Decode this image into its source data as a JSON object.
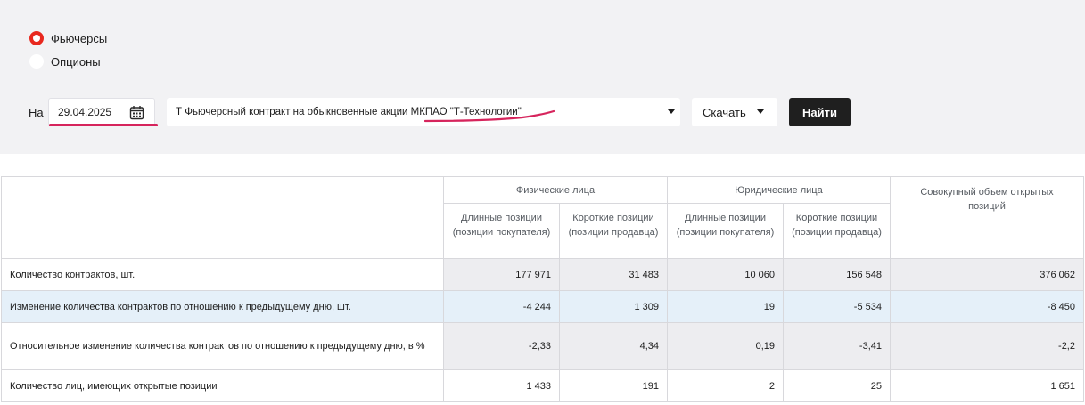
{
  "filters": {
    "radio_futures": "Фьючерсы",
    "radio_options": "Опционы",
    "na_label": "На",
    "date_value": "29.04.2025",
    "contract_value": "Т Фьючерсный контракт на обыкновенные акции МКПАО \"Т-Технологии\"",
    "download_label": "Скачать",
    "find_label": "Найти",
    "accent_color": "#e8281e",
    "annotation_color": "#d6245c"
  },
  "table": {
    "group_individuals": "Физические лица",
    "group_legal": "Юридические лица",
    "total_header": "Совокупный объем открытых позиций",
    "sub_long": "Длинные позиции (позиции покупателя)",
    "sub_short": "Короткие позиции (позиции продавца)",
    "rows": [
      {
        "label": "Количество контрактов, шт.",
        "values": [
          "177 971",
          "31 483",
          "10 060",
          "156 548",
          "376 062"
        ]
      },
      {
        "label": "Изменение количества контрактов по отношению к предыдущему дню, шт.",
        "values": [
          "-4 244",
          "1 309",
          "19",
          "-5 534",
          "-8 450"
        ]
      },
      {
        "label": "Относительное изменение количества контрактов по отношению к предыдущему дню, в %",
        "values": [
          "-2,33",
          "4,34",
          "0,19",
          "-3,41",
          "-2,2"
        ]
      },
      {
        "label": "Количество лиц, имеющих открытые позиции",
        "values": [
          "1 433",
          "191",
          "2",
          "25",
          "1 651"
        ]
      }
    ]
  }
}
